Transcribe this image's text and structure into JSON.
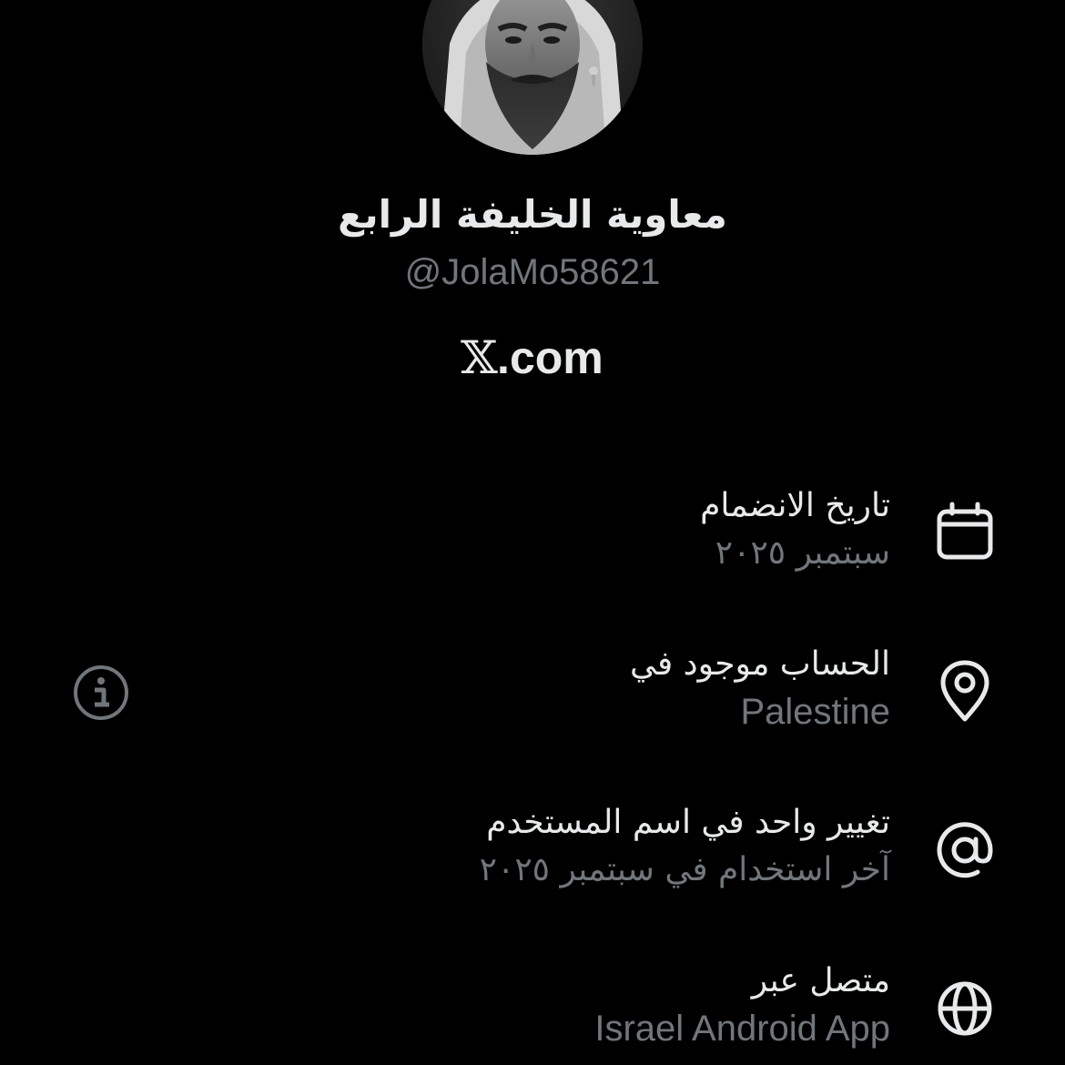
{
  "profile": {
    "display_name": "معاوية الخليفة الرابع",
    "handle": "@JolaMo58621",
    "brand_mark": "𝕏",
    "brand_text": ".com"
  },
  "about": {
    "rows": [
      {
        "icon": "calendar-icon",
        "title": "تاريخ الانضمام",
        "value": "سبتمبر ٢٠٢٥"
      },
      {
        "icon": "location-pin-icon",
        "title": "الحساب موجود في",
        "value": "Palestine"
      },
      {
        "icon": "at-sign-icon",
        "title": "تغيير واحد في اسم المستخدم",
        "value": "آخر استخدام في سبتمبر ٢٠٢٥"
      },
      {
        "icon": "globe-icon",
        "title": "متصل عبر",
        "value": "Israel Android App"
      }
    ]
  },
  "colors": {
    "background": "#000000",
    "primary_text": "#e7e9ea",
    "secondary_text": "#71767b"
  }
}
